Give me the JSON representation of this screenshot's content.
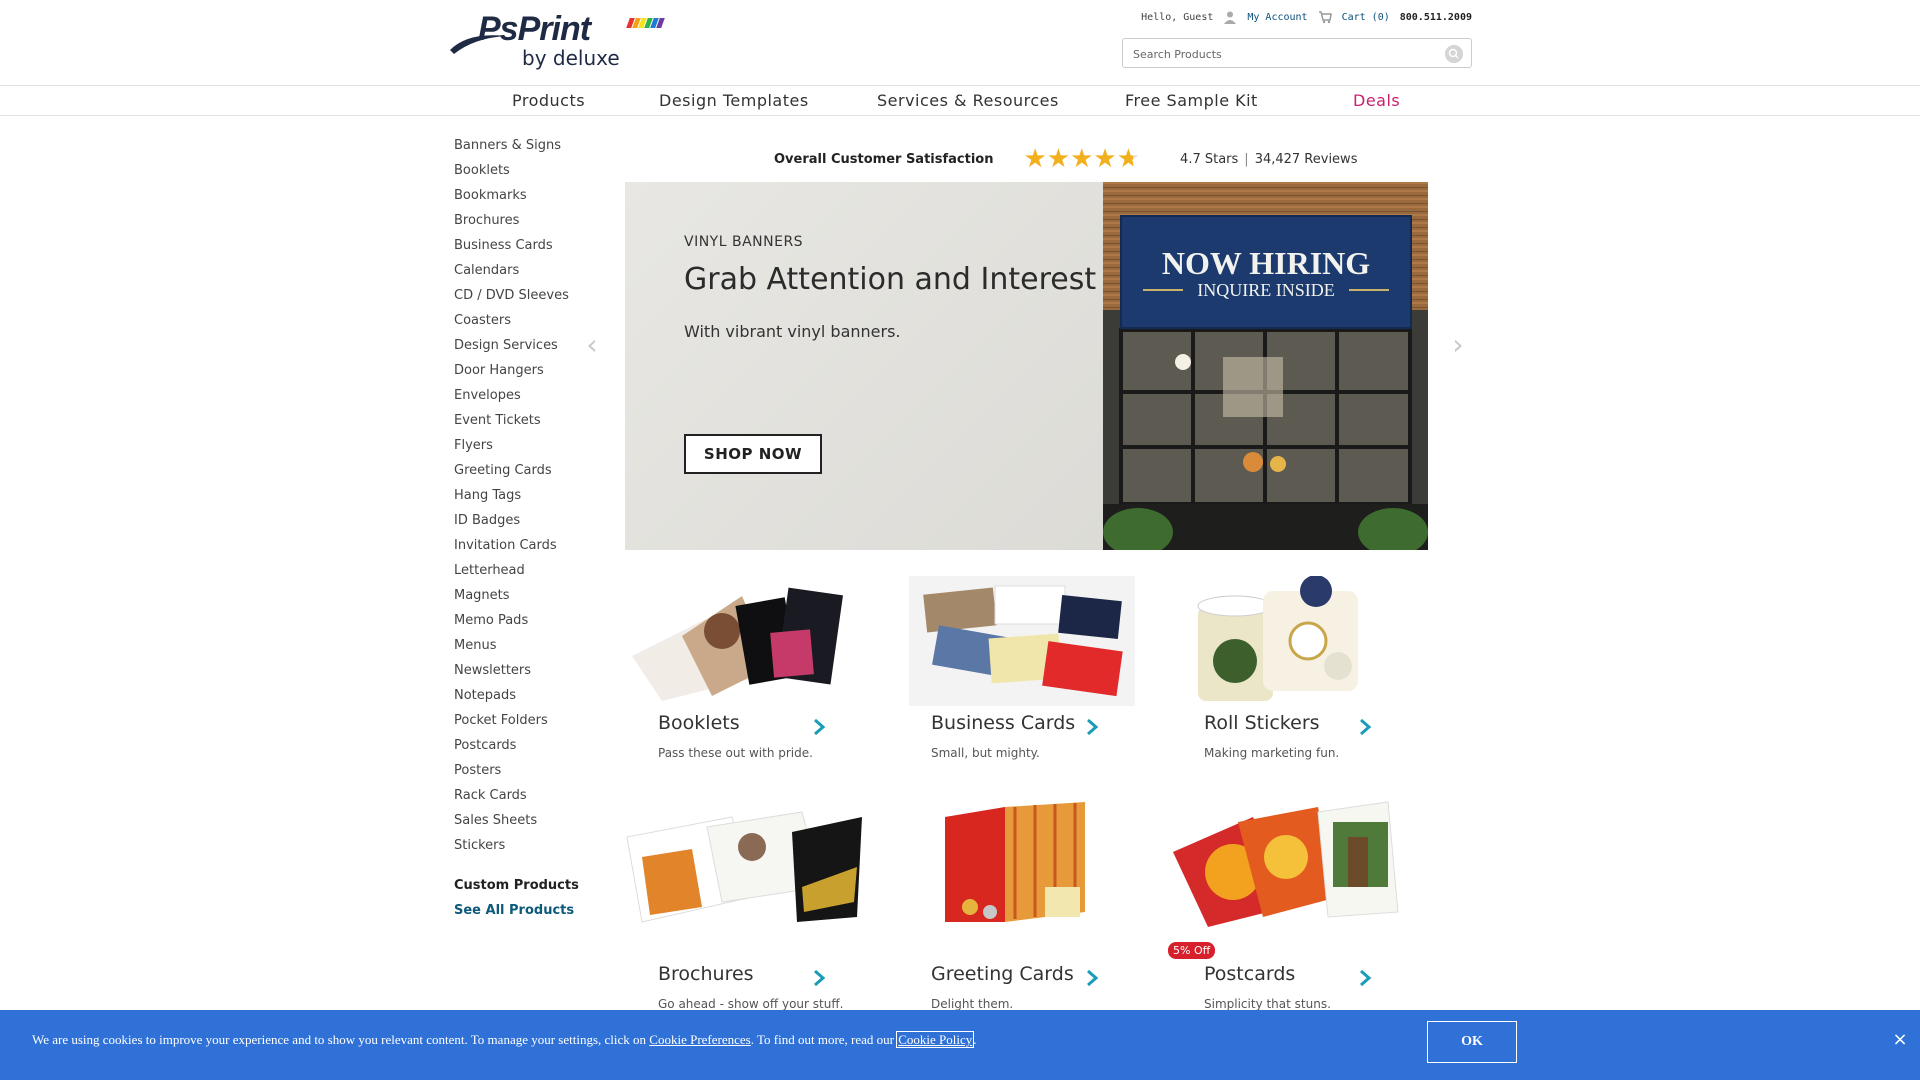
{
  "brand": {
    "logo_main": "PsPrint",
    "logo_sub": "by deluxe"
  },
  "utility": {
    "greeting": "Hello, Guest",
    "account": "My Account",
    "cart": "Cart (0)",
    "phone": "800.511.2009"
  },
  "search": {
    "placeholder": "Search Products"
  },
  "nav": [
    "Products",
    "Design Templates",
    "Services & Resources",
    "Free Sample Kit",
    "Deals"
  ],
  "sidebar": {
    "items": [
      "Banners & Signs",
      "Booklets",
      "Bookmarks",
      "Brochures",
      "Business Cards",
      "Calendars",
      "CD / DVD Sleeves",
      "Coasters",
      "Design Services",
      "Door Hangers",
      "Envelopes",
      "Event Tickets",
      "Flyers",
      "Greeting Cards",
      "Hang Tags",
      "ID Badges",
      "Invitation Cards",
      "Letterhead",
      "Magnets",
      "Memo Pads",
      "Menus",
      "Newsletters",
      "Notepads",
      "Pocket Folders",
      "Postcards",
      "Posters",
      "Rack Cards",
      "Sales Sheets",
      "Stickers"
    ],
    "custom": "Custom Products",
    "see_all": "See All Products"
  },
  "rating": {
    "label": "Overall Customer Satisfaction",
    "stars_value": 4.7,
    "stars_text": "4.7 Stars",
    "reviews_text": "34,427 Reviews"
  },
  "hero": {
    "eyebrow": "VINYL BANNERS",
    "title": "Grab Attention and Interest",
    "subtitle": "With vibrant vinyl banners.",
    "cta": "SHOP NOW",
    "banner_line1": "NOW HIRING",
    "banner_line2": "INQUIRE INSIDE"
  },
  "products": [
    {
      "name": "Booklets",
      "desc": "Pass these out with pride."
    },
    {
      "name": "Business Cards",
      "desc": "Small, but mighty."
    },
    {
      "name": "Roll Stickers",
      "desc": "Making marketing fun."
    },
    {
      "name": "Brochures",
      "desc": "Go ahead - show off your stuff."
    },
    {
      "name": "Greeting Cards",
      "desc": "Delight them."
    },
    {
      "name": "Postcards",
      "desc": "Simplicity that stuns."
    }
  ],
  "badge": "5% Off",
  "cookie": {
    "text_before": "We are using cookies to improve your experience and to show you relevant content. To manage your settings, click on ",
    "prefs_link": "Cookie Preferences",
    "text_middle": ". To find out more, read our ",
    "policy_link": "Cookie Policy",
    "text_after": ".",
    "ok": "OK",
    "close": "×"
  },
  "colors": {
    "accent": "#c8216f",
    "link": "#0d4f7a",
    "chevron": "#1a9bb8",
    "cookie_bg": "#2f71d6",
    "star": "#f2b01e"
  },
  "icons": [
    "user-icon",
    "cart-icon",
    "search-icon",
    "chevron-left-icon",
    "chevron-right-icon",
    "close-icon"
  ]
}
